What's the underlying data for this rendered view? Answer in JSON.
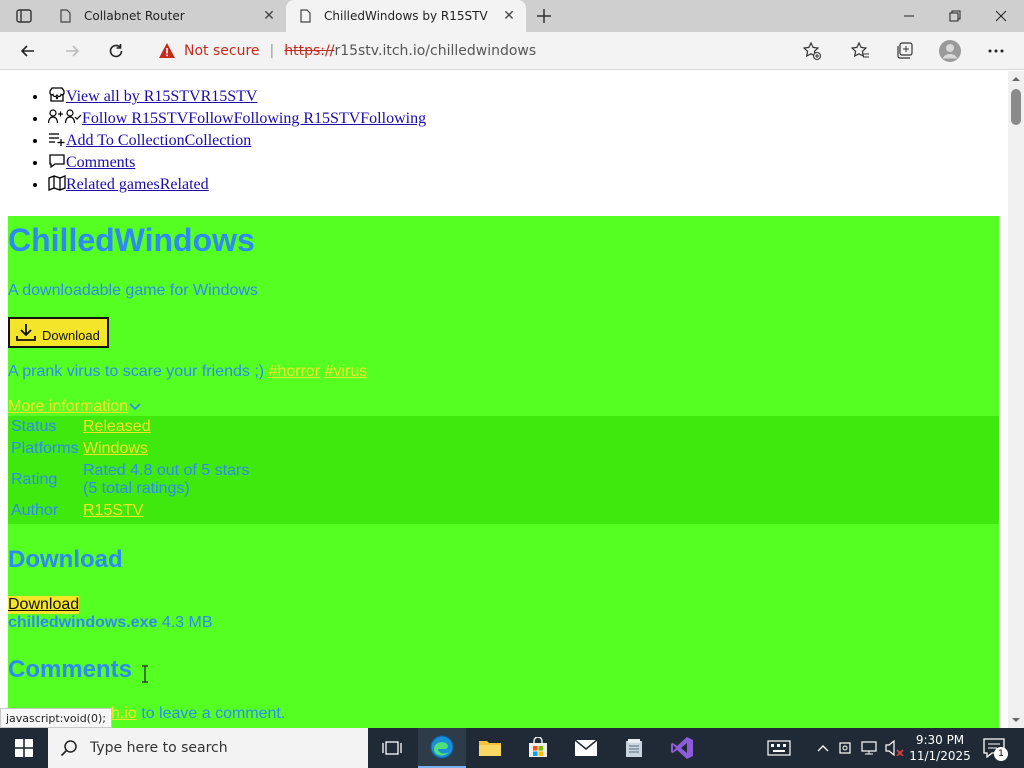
{
  "browser": {
    "tabs": [
      {
        "title": "Collabnet Router",
        "active": false
      },
      {
        "title": "ChilledWindows by R15STV",
        "active": true
      }
    ],
    "address": {
      "security_label": "Not secure",
      "url_scheme": "https://",
      "url_rest": "r15stv.itch.io/chilledwindows"
    },
    "status_tooltip": "javascript:void(0);"
  },
  "page": {
    "nav_links": [
      {
        "label": "View all by R15STVR15STV",
        "icon": "itch-icon"
      },
      {
        "label": "Follow R15STVFollowFollowing R15STVFollowing",
        "icon": "follow-user-icon"
      },
      {
        "label": "Add To CollectionCollection",
        "icon": "add-list-icon"
      },
      {
        "label": "Comments",
        "icon": "comment-icon"
      },
      {
        "label": "Related gamesRelated",
        "icon": "map-icon"
      }
    ],
    "game": {
      "title": "ChilledWindows",
      "subtitle": "A downloadable game for Windows",
      "download_button": "Download",
      "description": "A prank virus to scare your friends ;)",
      "tags": [
        "#horror",
        "#virus"
      ],
      "more_information": "More information",
      "info": {
        "status_label": "Status",
        "status_value": "Released",
        "platforms_label": "Platforms",
        "platforms_value": "Windows",
        "rating_label": "Rating",
        "rating_value_1": "Rated 4.8 out of 5 stars",
        "rating_value_2": "(5 total ratings)",
        "rating_stars": 4.8,
        "author_label": "Author",
        "author_value": "R15STV"
      },
      "download_heading": "Download",
      "download_link": "Download",
      "file_name": "chilledwindows.exe",
      "file_size": "4.3 MB",
      "comments_heading": "Comments",
      "login_partial_link": "ch.io",
      "login_suffix": " to leave a comment."
    }
  },
  "taskbar": {
    "search_placeholder": "Type here to search",
    "time": "9:30 PM",
    "date": "11/1/2025",
    "notification_count": "1"
  },
  "colors": {
    "page_bg": "#56ff22",
    "table_bg": "#3fe80d",
    "heading_blue": "#2d8cf0",
    "accent_yellow": "#f5e52a",
    "not_secure_red": "#c42b1c"
  }
}
